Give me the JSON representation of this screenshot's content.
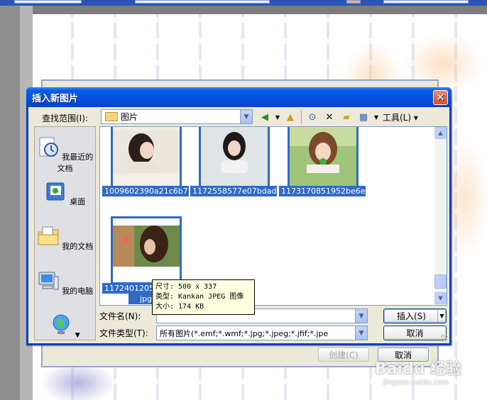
{
  "dialog": {
    "title": "插入新图片",
    "lookin_label": "查找范围(I):",
    "lookin_value": "图片",
    "tools_label": "工具(L)",
    "places": [
      {
        "label": "我最近的文档",
        "icon": "recent-documents-icon"
      },
      {
        "label": "桌面",
        "icon": "desktop-icon"
      },
      {
        "label": "我的文档",
        "icon": "my-documents-icon"
      },
      {
        "label": "我的电脑",
        "icon": "my-computer-icon"
      },
      {
        "label": "",
        "icon": "network-places-icon"
      }
    ],
    "files": [
      {
        "name": "1009602390a21c6b7..."
      },
      {
        "name": "1172558577e07bdad..."
      },
      {
        "name": "1173170851952be6e..."
      },
      {
        "name_line1": "117240120578",
        "name_line2": "jpg"
      }
    ],
    "tooltip": {
      "size": "尺寸: 500 x 337",
      "type": "类型: Kankan JPEG 图像",
      "filesize": "大小: 174 KB"
    },
    "filename_label": "文件名(N):",
    "filename_value": "",
    "filetype_label": "文件类型(T):",
    "filetype_value": "所有图片(*.emf;*.wmf;*.jpg;*.jpeg;*.jfif;*.jpe",
    "insert_button": "插入(S)",
    "cancel_button": "取消"
  },
  "background_dialog": {
    "create_button": "创建(C)",
    "cancel_button": "取消"
  },
  "watermark": {
    "brand": "Baidu 经验",
    "url": "jingyan.baidu.com"
  },
  "colors": {
    "titlebar": "#0450e0",
    "selection": "#316ac5",
    "dialog_bg": "#ece9d8"
  }
}
